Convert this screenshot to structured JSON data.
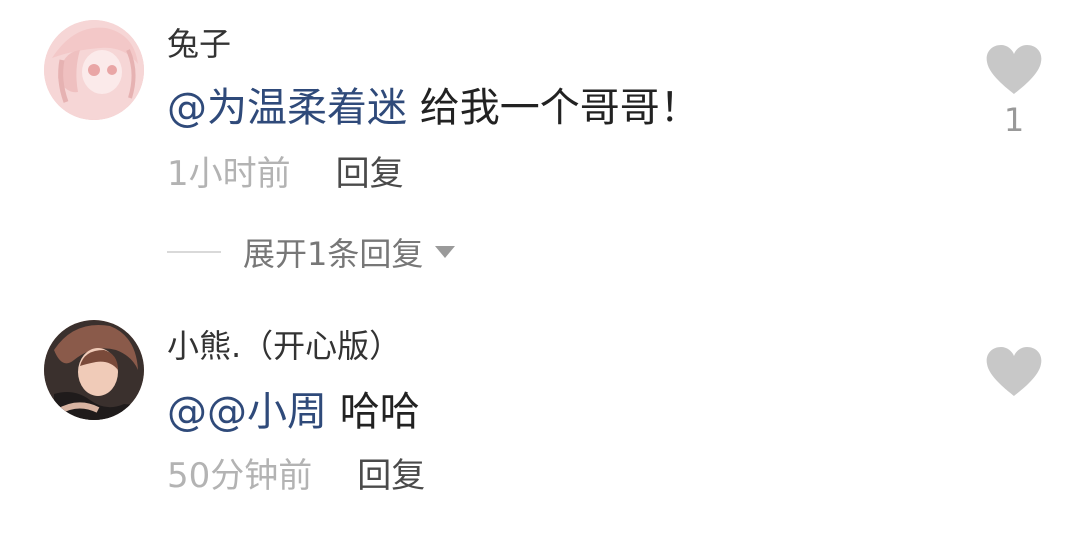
{
  "comments": [
    {
      "username": "兔子",
      "mention": "@为温柔着迷",
      "text": " 给我一个哥哥！",
      "time": "1小时前",
      "reply_label": "回复",
      "like_count": "1",
      "expand_label": "展开1条回复"
    },
    {
      "username": "小熊.（开心版）",
      "mention": "@@小周",
      "text": " 哈哈",
      "time": "50分钟前",
      "reply_label": "回复"
    }
  ],
  "colors": {
    "mention": "#2f4a7a",
    "heart": "#c8c8c8",
    "muted": "#b3b3b3"
  },
  "icons": {
    "like": "heart-icon",
    "expand": "caret-down-icon"
  }
}
